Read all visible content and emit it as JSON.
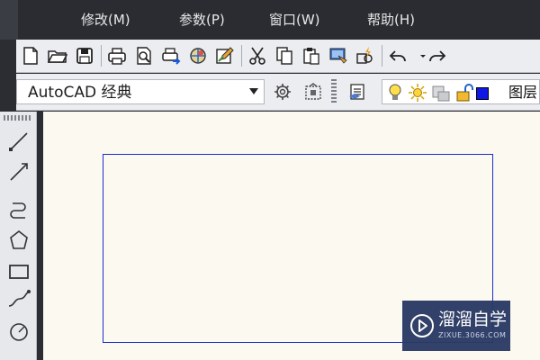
{
  "menu": {
    "items": [
      {
        "label": "修改(M)"
      },
      {
        "label": "参数(P)"
      },
      {
        "label": "窗口(W)"
      },
      {
        "label": "帮助(H)"
      }
    ]
  },
  "workspace": {
    "selected": "AutoCAD 经典"
  },
  "layers": {
    "label": "图层"
  },
  "drawing": {
    "stroke_color": "#1b2ccf",
    "background": "#fcf9f1"
  },
  "watermark": {
    "name": "溜溜自学",
    "url": "ZIXUE.3066.COM"
  },
  "colors": {
    "menubar": "#2a2c31",
    "toolbar": "#ecedf0",
    "watermark_bg": "#2a3a64"
  },
  "icons": {
    "toolbar_row1": [
      "new-file-icon",
      "open-folder-icon",
      "save-icon",
      "print-icon",
      "print-preview-icon",
      "publish-icon",
      "3d-dwf-icon",
      "edit-icon",
      "cut-icon",
      "copy-icon",
      "paste-icon",
      "match-properties-icon",
      "block-editor-icon",
      "undo-icon"
    ],
    "toolbar_row2": [
      "workspace-settings-icon",
      "customize-icon",
      "layer-manager-icon",
      "lightbulb-icon",
      "sun-icon",
      "freeze-icon",
      "unlock-icon",
      "color-swatch-icon"
    ],
    "left_toolbar": [
      "line-icon",
      "construction-line-icon",
      "polyline-icon",
      "polygon-icon",
      "rectangle-icon",
      "spline-icon",
      "circle-icon"
    ]
  }
}
